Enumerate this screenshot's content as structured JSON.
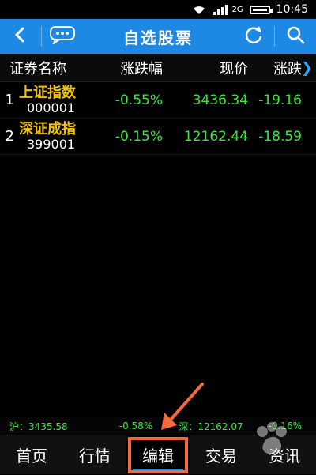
{
  "status": {
    "network": "2G",
    "time": "10:45",
    "icons": [
      "wifi-icon",
      "signal-icon",
      "battery-icon"
    ]
  },
  "titlebar": {
    "title": "自选股票",
    "icons": [
      "back-icon",
      "message-icon",
      "refresh-icon",
      "search-icon"
    ]
  },
  "table": {
    "headers": [
      "证券名称",
      "涨跌幅",
      "现价",
      "涨跌"
    ],
    "rows": [
      {
        "index": "1",
        "name": "上证指数",
        "code": "000001",
        "change_pct": "-0.55%",
        "price": "3436.34",
        "change": "-19.16"
      },
      {
        "index": "2",
        "name": "深证成指",
        "code": "399001",
        "change_pct": "-0.15%",
        "price": "12162.44",
        "change": "-18.59"
      }
    ]
  },
  "ticker": {
    "sh": "沪：3435.58",
    "sh_change": "-0.58%",
    "sz": "深：12162.07",
    "sz_change": "-0.16%"
  },
  "tabs": [
    {
      "label": "首页"
    },
    {
      "label": "行情"
    },
    {
      "label": "编辑"
    },
    {
      "label": "交易"
    },
    {
      "label": "资讯"
    }
  ],
  "annotation": {
    "highlight_color": "#f26a3d"
  },
  "colors": {
    "accent": "#1e88e5",
    "green": "#3fe53f",
    "name": "#f2c200",
    "background": "#000000"
  }
}
